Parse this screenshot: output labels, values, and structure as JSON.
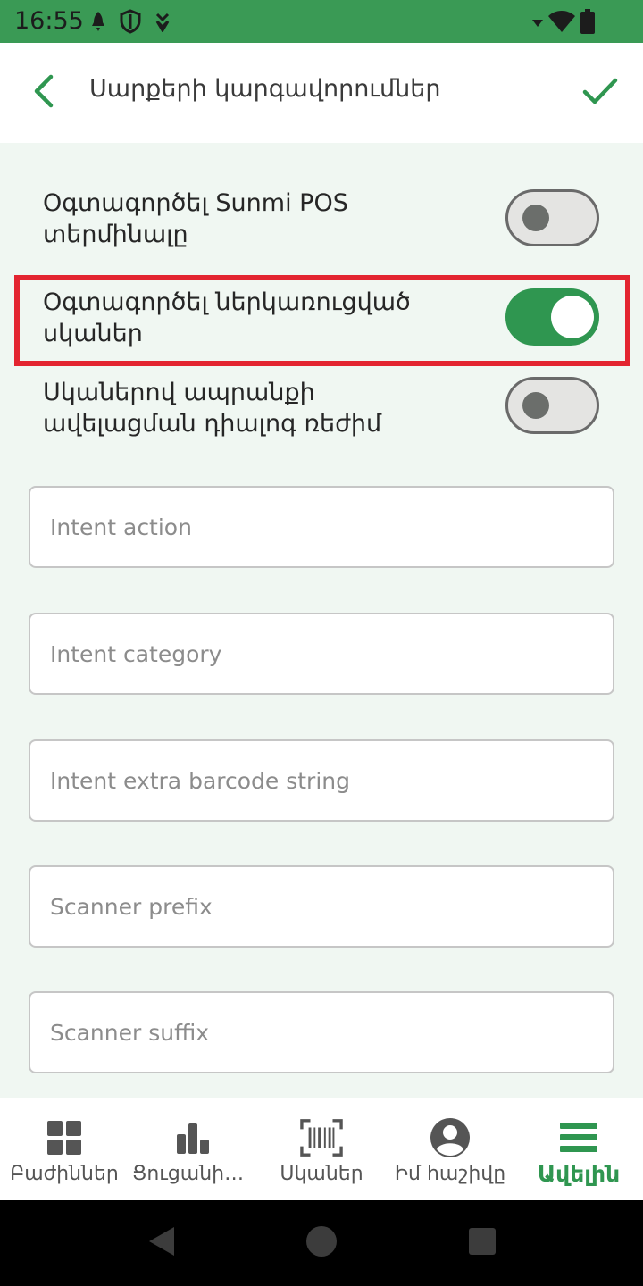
{
  "status_bar": {
    "time": "16:55",
    "icons_left": [
      "notification-icon",
      "shield-icon",
      "download-icon"
    ],
    "icons_right": [
      "signal-icon",
      "wifi-icon",
      "battery-icon"
    ]
  },
  "app_bar": {
    "title": "Սարքերի կարգավորումներ",
    "back_icon": "chevron-left-icon",
    "confirm_icon": "checkmark-icon"
  },
  "settings": {
    "toggles": [
      {
        "label": "Օգտագործել Sunmi POS տերմինալը",
        "on": false
      },
      {
        "label": "Օգտագործել ներկառուցված սկաներ",
        "on": true
      },
      {
        "label": "Սկաներով ապրանքի ավելացման դիալոգ ռեժիմ",
        "on": false
      }
    ],
    "fields": [
      {
        "placeholder": "Intent action",
        "value": ""
      },
      {
        "placeholder": "Intent category",
        "value": ""
      },
      {
        "placeholder": "Intent extra barcode string",
        "value": ""
      },
      {
        "placeholder": "Scanner prefix",
        "value": ""
      },
      {
        "placeholder": "Scanner suffix",
        "value": ""
      }
    ]
  },
  "bottom_nav": {
    "items": [
      {
        "label": "Բաժիններ",
        "icon": "grid-icon",
        "active": false
      },
      {
        "label": "Ցուցանիշներ",
        "icon": "bar-chart-icon",
        "active": false
      },
      {
        "label": "Սկաներ",
        "icon": "barcode-scanner-icon",
        "active": false
      },
      {
        "label": "Իմ հաշիվը",
        "icon": "account-icon",
        "active": false
      },
      {
        "label": "Ավելին",
        "icon": "menu-icon",
        "active": true
      }
    ]
  },
  "colors": {
    "primary": "#2f9650",
    "status_bar": "#3a9a55",
    "background": "#f0f7f2",
    "highlight": "#e32530"
  }
}
